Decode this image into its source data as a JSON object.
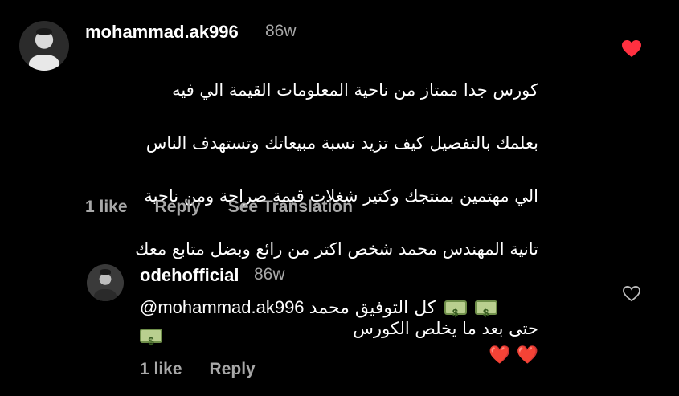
{
  "comment": {
    "username": "mohammad.ak996",
    "time": "86w",
    "lines": [
      "كورس جدا ممتاز من ناحية المعلومات القيمة الي فيه",
      "بعلمك بالتفصيل كيف تزيد نسبة مبيعاتك وتستهدف الناس",
      "الي مهتمين بمنتجك وكتير شغلات قيمة صراحة ومن ناحية",
      "تانية المهندس محمد شخص اكتر من رائع وبضل متابع معك",
      "حتى بعد ما يخلص الكورس"
    ],
    "hearts": "❤️ ❤️",
    "likes": "1 like",
    "reply_label": "Reply",
    "translate_label": "See Translation"
  },
  "reply": {
    "username": "odehofficial",
    "time": "86w",
    "mention": "@mohammad.ak996",
    "text": "كل التوفيق محمد",
    "likes": "1 like",
    "reply_label": "Reply"
  },
  "colors": {
    "liked_heart": "#ff3040",
    "muted_text": "#a8a8a8"
  },
  "icons": {
    "comment_like": "heart-filled-icon",
    "reply_like": "heart-outline-icon"
  }
}
